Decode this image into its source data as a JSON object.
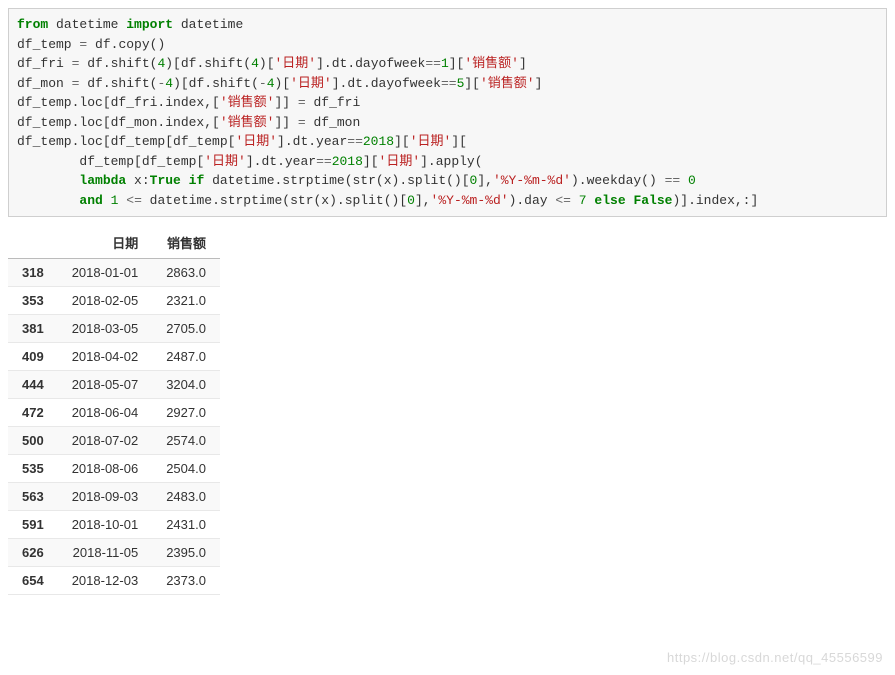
{
  "code": {
    "line1": {
      "kw_from": "from",
      "mod": " datetime ",
      "kw_import": "import",
      "rest": " datetime"
    },
    "line2": {
      "a": "df_temp ",
      "op": "=",
      "b": " df.copy()"
    },
    "line3": {
      "a": "df_fri ",
      "op": "=",
      "b1": " df.shift(",
      "n1": "4",
      "b2": ")[df.shift(",
      "n2": "4",
      "b3": ")[",
      "s1": "'日期'",
      "b4": "].dt.dayofweek",
      "op2": "==",
      "n3": "1",
      "b5": "][",
      "s2": "'销售额'",
      "b6": "]"
    },
    "line4": {
      "a": "df_mon ",
      "op": "=",
      "b1": " df.shift(",
      "n1": "-",
      "n1b": "4",
      "b2": ")[df.shift(",
      "n2": "-",
      "n2b": "4",
      "b3": ")[",
      "s1": "'日期'",
      "b4": "].dt.dayofweek",
      "op2": "==",
      "n3": "5",
      "b5": "][",
      "s2": "'销售额'",
      "b6": "]"
    },
    "line5": {
      "a": "df_temp.loc[df_fri.index,[",
      "s1": "'销售额'",
      "b": "]] ",
      "op": "=",
      "c": " df_fri"
    },
    "line6": {
      "a": "df_temp.loc[df_mon.index,[",
      "s1": "'销售额'",
      "b": "]] ",
      "op": "=",
      "c": " df_mon"
    },
    "line7": {
      "a": "df_temp.loc[df_temp[df_temp[",
      "s1": "'日期'",
      "b": "].dt.year",
      "op": "==",
      "n1": "2018",
      "c": "][",
      "s2": "'日期'",
      "d": "]["
    },
    "line8": {
      "pad": "        ",
      "a": "df_temp[df_temp[",
      "s1": "'日期'",
      "b": "].dt.year",
      "op": "==",
      "n1": "2018",
      "c": "][",
      "s2": "'日期'",
      "d": "].apply("
    },
    "line9": {
      "pad": "        ",
      "kw_lambda": "lambda",
      "a": " x:",
      "kw_true": "True",
      "b": " ",
      "kw_if": "if",
      "c": " datetime.strptime(str(x).split()[",
      "n0": "0",
      "d": "],",
      "s1": "'%Y-%m-%d'",
      "e": ").weekday() ",
      "op": "==",
      "sp": " ",
      "n1": "0"
    },
    "line10": {
      "pad": "        ",
      "kw_and": "and",
      "sp1": " ",
      "n1": "1",
      "sp2": " ",
      "op_le": "<=",
      "a": " datetime.strptime(str(x).split()[",
      "n0": "0",
      "b": "],",
      "s1": "'%Y-%m-%d'",
      "c": ").day ",
      "op_le2": "<=",
      "sp3": " ",
      "n2": "7",
      "sp4": " ",
      "kw_else": "else",
      "sp5": " ",
      "kw_false": "False",
      "d": ")].index,:]"
    }
  },
  "table": {
    "columns": [
      "日期",
      "销售额"
    ],
    "rows": [
      {
        "idx": "318",
        "date": "2018-01-01",
        "val": "2863.0"
      },
      {
        "idx": "353",
        "date": "2018-02-05",
        "val": "2321.0"
      },
      {
        "idx": "381",
        "date": "2018-03-05",
        "val": "2705.0"
      },
      {
        "idx": "409",
        "date": "2018-04-02",
        "val": "2487.0"
      },
      {
        "idx": "444",
        "date": "2018-05-07",
        "val": "3204.0"
      },
      {
        "idx": "472",
        "date": "2018-06-04",
        "val": "2927.0"
      },
      {
        "idx": "500",
        "date": "2018-07-02",
        "val": "2574.0"
      },
      {
        "idx": "535",
        "date": "2018-08-06",
        "val": "2504.0"
      },
      {
        "idx": "563",
        "date": "2018-09-03",
        "val": "2483.0"
      },
      {
        "idx": "591",
        "date": "2018-10-01",
        "val": "2431.0"
      },
      {
        "idx": "626",
        "date": "2018-11-05",
        "val": "2395.0"
      },
      {
        "idx": "654",
        "date": "2018-12-03",
        "val": "2373.0"
      }
    ]
  },
  "watermark": "https://blog.csdn.net/qq_45556599"
}
